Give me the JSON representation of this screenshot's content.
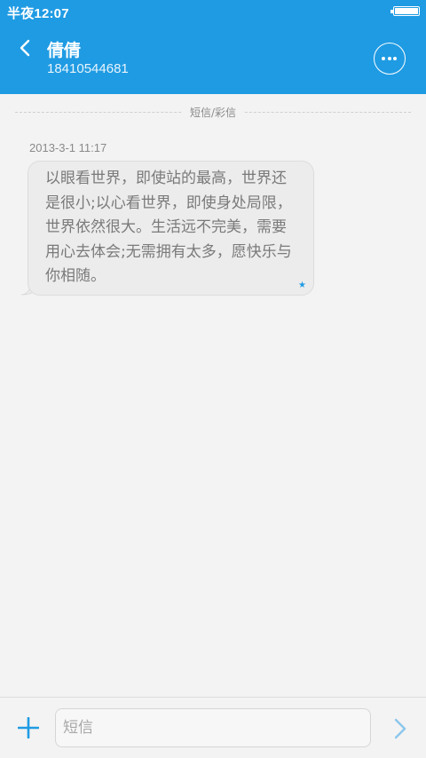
{
  "status_bar": {
    "time": "半夜12:07"
  },
  "header": {
    "contact_name": "倩倩",
    "contact_number": "18410544681"
  },
  "conversation": {
    "divider_label": "短信/彩信",
    "messages": [
      {
        "timestamp": "2013-3-1 11:17",
        "text": "以眼看世界，即使站的最高，世界还是很小;以心看世界，即使身处局限，世界依然很大。生活远不完美，需要用心去体会;无需拥有太多，愿快乐与你相随。",
        "star": "★"
      }
    ]
  },
  "composer": {
    "placeholder": "短信"
  },
  "colors": {
    "accent": "#1f9be3",
    "background": "#f3f3f3",
    "bubble": "#ececec"
  },
  "icons": {
    "back": "chevron-left-icon",
    "more": "more-horizontal-icon",
    "add": "plus-icon",
    "send": "chevron-right-icon",
    "battery": "battery-icon"
  }
}
